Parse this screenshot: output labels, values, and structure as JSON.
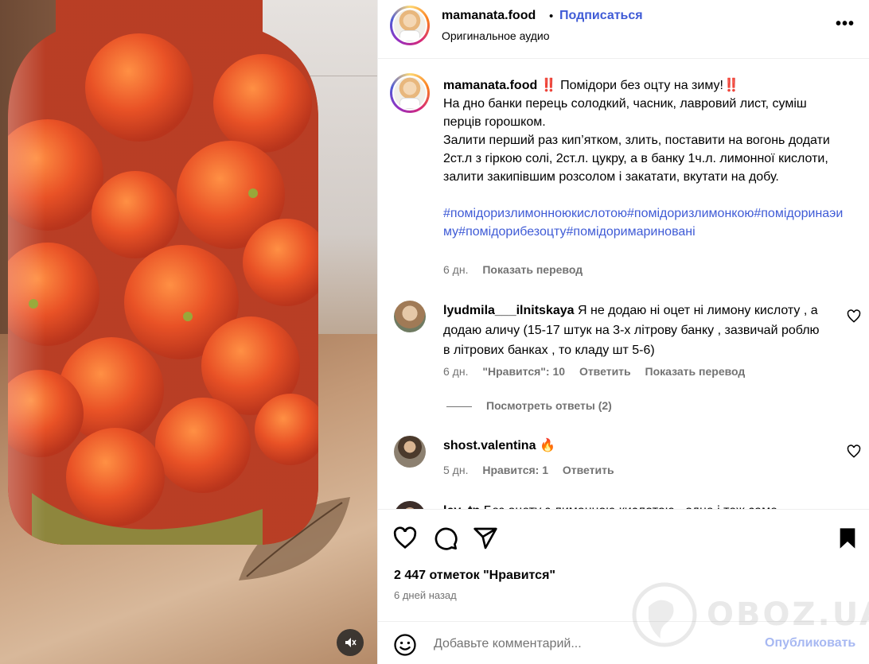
{
  "post": {
    "username": "mamanata.food",
    "dot": "•",
    "follow_label": "Подписаться",
    "audio_label": "Оригинальное аудио",
    "more_label": "•••"
  },
  "caption": {
    "username": "mamanata.food",
    "emoji_start": "‼️",
    "title": "Помідори без оцту на зиму!",
    "emoji_end": "‼️",
    "lines": [
      "На дно банки перець солодкий, часник, лавровий лист, суміш перців горошком.",
      "Залити перший раз кип’ятком, злить, поставити на вогонь додати 2ст.л з гіркою солі, 2ст.л. цукру, а в банку 1ч.л. лимонної кислоти, залити закипівшим розсолом і закатати, вкутати на добу."
    ],
    "hashtags": "#помідоризлимонноюкислотою#помідоризлимонкою#помідоринаэиму#помідорибезоцту#помідоримариновані",
    "time": "6 дн.",
    "translate_label": "Показать перевод"
  },
  "comments": [
    {
      "username": "lyudmila___ilnitskaya",
      "text": "Я не додаю ні оцет ні лимону кислоту , а додаю аличу (15-17 штук на 3-х літрову банку , зазвичай роблю в літрових банках , то кладу шт 5-6)",
      "time": "6 дн.",
      "likes": "\"Нравится\": 10",
      "reply_label": "Ответить",
      "translate_label": "Показать перевод",
      "view_replies": "Посмотреть ответы (2)"
    },
    {
      "username": "shost.valentina",
      "text": "🔥",
      "time": "5 дн.",
      "likes": "Нравится: 1",
      "reply_label": "Ответить"
    },
    {
      "username": "lev_tn",
      "text": "Без оцету з лимонною кислотою , одне і теж саме"
    }
  ],
  "footer": {
    "likes_count": "2 447 отметок \"Нравится\"",
    "date": "6 дней назад",
    "comment_placeholder": "Добавьте комментарий...",
    "publish_label": "Опубликовать"
  },
  "watermark": {
    "text": "OBOZ.UA"
  },
  "colors": {
    "link_blue": "#3f5bd6",
    "publish_disabled": "#a7b8f2",
    "secondary_text": "#737373",
    "border": "#efefef"
  },
  "icons": [
    "mute-icon",
    "more-icon",
    "heart-icon",
    "comment-icon",
    "share-icon",
    "bookmark-icon",
    "emoji-icon"
  ]
}
